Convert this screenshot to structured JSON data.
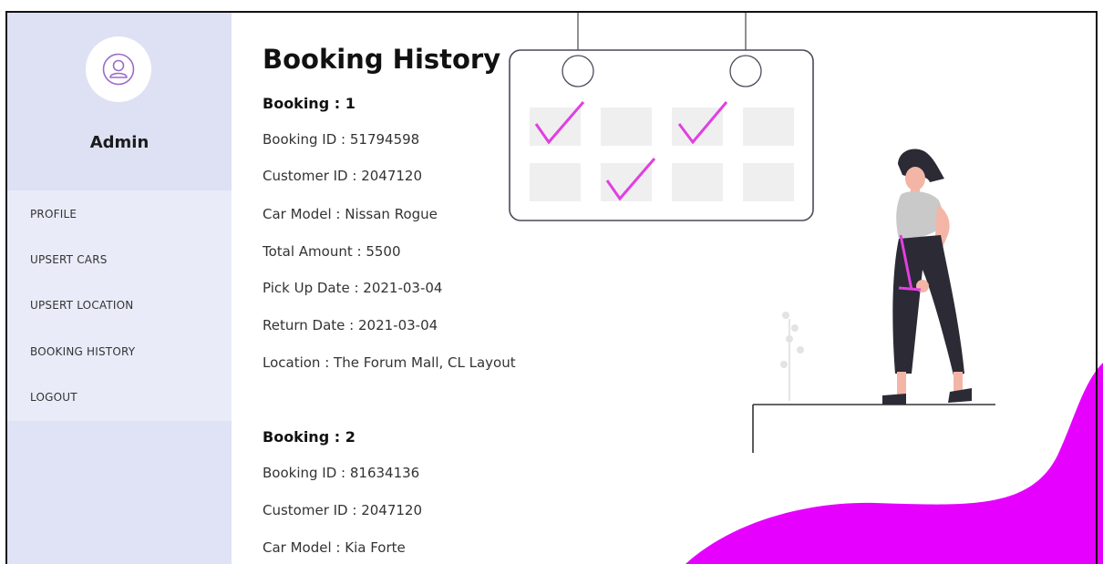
{
  "sidebar": {
    "admin_name": "Admin",
    "menu": [
      {
        "label": "PROFILE"
      },
      {
        "label": "UPSERT CARS"
      },
      {
        "label": "UPSERT LOCATION"
      },
      {
        "label": "BOOKING HISTORY"
      },
      {
        "label": "LOGOUT"
      }
    ]
  },
  "main": {
    "title": "Booking History",
    "bookings": [
      {
        "heading": "Booking : 1",
        "booking_id": "Booking ID : 51794598",
        "customer_id": "Customer ID : 2047120",
        "car_model": "Car Model : Nissan Rogue",
        "total_amount": "Total Amount : 5500",
        "pick_up_date": "Pick Up Date : 2021-03-04",
        "return_date": "Return Date : 2021-03-04",
        "location": "Location : The Forum Mall, CL Layout"
      },
      {
        "heading": "Booking : 2",
        "booking_id": "Booking ID : 81634136",
        "customer_id": "Customer ID : 2047120",
        "car_model": "Car Model : Kia Forte"
      }
    ]
  },
  "icons": {
    "avatar": "user-icon",
    "illustration": "calendar-person-illustration"
  },
  "colors": {
    "sidebar_bg": "#dfe3f5",
    "menu_bg": "#e9ecf8",
    "accent": "#e600ff",
    "check": "#e040e0",
    "avatar_stroke": "#9a6cc9"
  }
}
